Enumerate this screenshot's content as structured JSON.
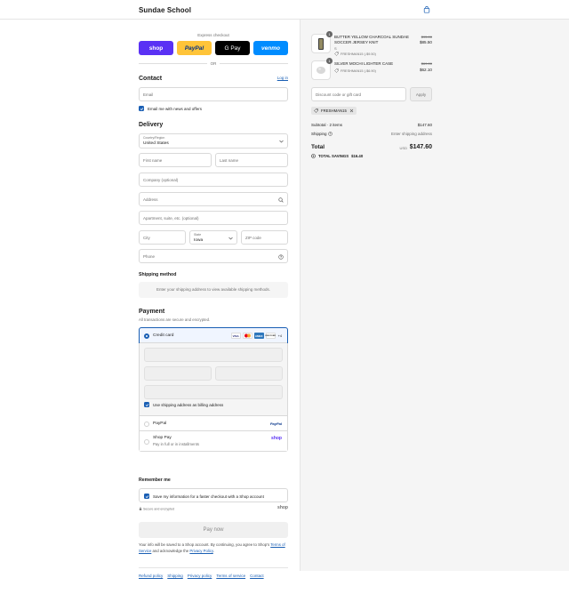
{
  "header": {
    "brand": "Sundae School",
    "cart_icon": "bag-icon"
  },
  "express": {
    "label": "Express checkout",
    "buttons": {
      "shop": "shop",
      "paypal": "PayPal",
      "gpay": "G Pay",
      "venmo": "venmo"
    },
    "or": "OR"
  },
  "contact": {
    "title": "Contact",
    "login": "Log in",
    "email_placeholder": "Email",
    "news_label": "Email me with news and offers"
  },
  "delivery": {
    "title": "Delivery",
    "country_label": "Country/Region",
    "country_value": "United States",
    "first_name": "First name",
    "last_name": "Last name",
    "company": "Company (optional)",
    "address": "Address",
    "apartment": "Apartment, suite, etc. (optional)",
    "city": "City",
    "state_label": "State",
    "state_value": "Iowa",
    "zip": "ZIP code",
    "phone": "Phone"
  },
  "shipping": {
    "title": "Shipping method",
    "notice": "Enter your shipping address to view available shipping methods."
  },
  "payment": {
    "title": "Payment",
    "subtitle": "All transactions are secure and encrypted.",
    "credit_card": "Credit card",
    "card_logos": {
      "visa": "VISA",
      "mc": "MC",
      "amex": "AMEX",
      "discover": "DISCOVER"
    },
    "more_cards": "+4",
    "billing_same": "Use shipping address as billing address",
    "paypal": "PayPal",
    "paypal_logo": "PayPal",
    "shop_pay": "Shop Pay",
    "shop_pay_sub": "Pay in full or in installments",
    "shop_pay_logo": "shop"
  },
  "remember": {
    "title": "Remember me",
    "save_label": "Save my information for a faster checkout with a Shop account",
    "secure": "Secure and encrypted",
    "shop_logo": "shop"
  },
  "pay_now": "Pay now",
  "legal": {
    "text_before": "Your info will be saved to a Shop account. By continuing, you agree to Shop's ",
    "tos": "Terms of Service",
    "text_mid": " and acknowledge the ",
    "privacy": "Privacy Policy",
    "text_end": "."
  },
  "footer_links": [
    "Refund policy",
    "Shipping",
    "Privacy policy",
    "Terms of service",
    "Contact"
  ],
  "order": {
    "items": [
      {
        "qty": "1",
        "name": "BUTTER YELLOW CHARCOAL SUNDAE SOCCER JERSEY KNIT",
        "variant": "S",
        "discount": "FRESHMAN15 (-$9.50)",
        "original": "$95.00",
        "price": "$85.50"
      },
      {
        "qty": "1",
        "name": "SILVER MOCHI LIGHTER CASE",
        "variant": "",
        "discount": "FRESHMAN15 (-$6.90)",
        "original": "$69.00",
        "price": "$62.10"
      }
    ],
    "discount_placeholder": "Discount code or gift card",
    "apply": "Apply",
    "applied_code": "FRESHMAN15",
    "subtotal_label": "Subtotal · 2 items",
    "subtotal": "$147.60",
    "shipping_label": "Shipping",
    "shipping_value": "Enter shipping address",
    "total_label": "Total",
    "currency": "USD",
    "total": "$147.60",
    "savings_label": "TOTAL SAVINGS",
    "savings": "$16.40"
  },
  "colors": {
    "accent": "#1a5fb4",
    "shop": "#5a31f4",
    "paypal": "#ffc439",
    "venmo": "#008cff"
  }
}
